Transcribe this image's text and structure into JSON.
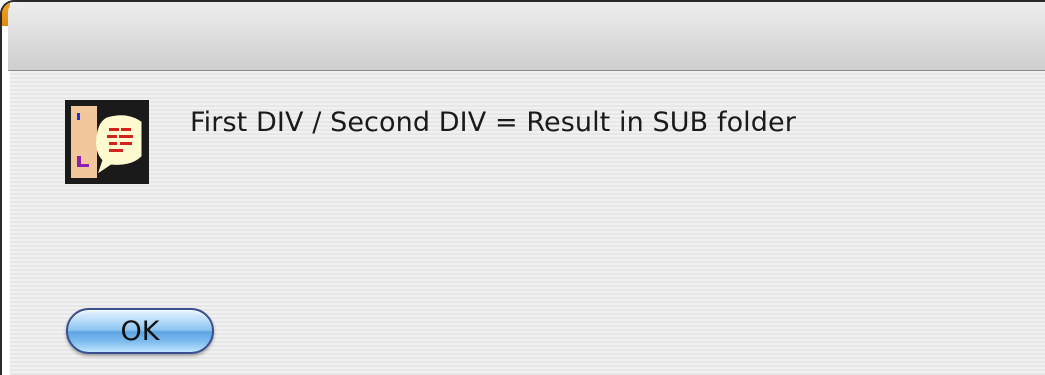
{
  "dialog": {
    "message": "First DIV / Second DIV = Result in SUB folder",
    "icon": "document-speech-bubble-icon",
    "ok_label": "OK"
  },
  "colors": {
    "titlebar": "#dcdcdc",
    "content_background": "#ececec",
    "button_blue": "#5da3e3",
    "window_accent": "#f5a623"
  }
}
